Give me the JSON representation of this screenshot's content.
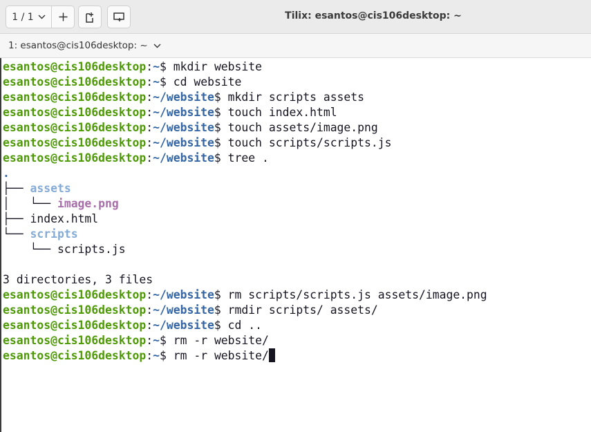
{
  "header": {
    "session_counter": "1 / 1",
    "window_title": "Tilix: esantos@cis106desktop: ~"
  },
  "tabbar": {
    "session_label": "1: esantos@cis106desktop: ~"
  },
  "prompt": {
    "user_host": "esantos@cis106desktop",
    "colon": ":",
    "home": "~",
    "website_path": "~/website",
    "dollar": "$ "
  },
  "terminal": {
    "cmds": [
      "mkdir website",
      "cd website",
      "mkdir scripts assets",
      "touch index.html",
      "touch assets/image.png",
      "touch scripts/scripts.js",
      "tree .",
      "rm scripts/scripts.js assets/image.png",
      "rmdir scripts/ assets/",
      "cd ..",
      "rm -r website/",
      "rm -r website/"
    ],
    "tree": {
      "root": ".",
      "line1_prefix": "├── ",
      "line1": "assets",
      "line2_prefix": "│   └── ",
      "line2": "image.png",
      "line3_prefix": "├── ",
      "line3": "index.html",
      "line4_prefix": "└── ",
      "line4": "scripts",
      "line5_prefix": "    └── ",
      "line5": "scripts.js",
      "summary": "3 directories, 3 files"
    }
  },
  "icons": {
    "chevron": "chevron-down-icon",
    "add": "plus-icon",
    "new_session": "new-session-icon",
    "split": "split-terminal-icon"
  }
}
